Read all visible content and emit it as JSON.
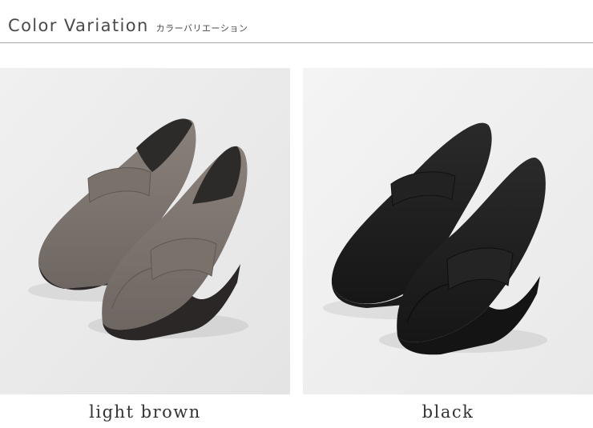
{
  "header": {
    "title": "Color Variation",
    "subtitle": "カラーバリエーション"
  },
  "variations": [
    {
      "label": "light brown",
      "color": "#7a716b",
      "sole": "#2a2726"
    },
    {
      "label": "black",
      "color": "#1f1f1f",
      "sole": "#1a1a1a"
    }
  ]
}
